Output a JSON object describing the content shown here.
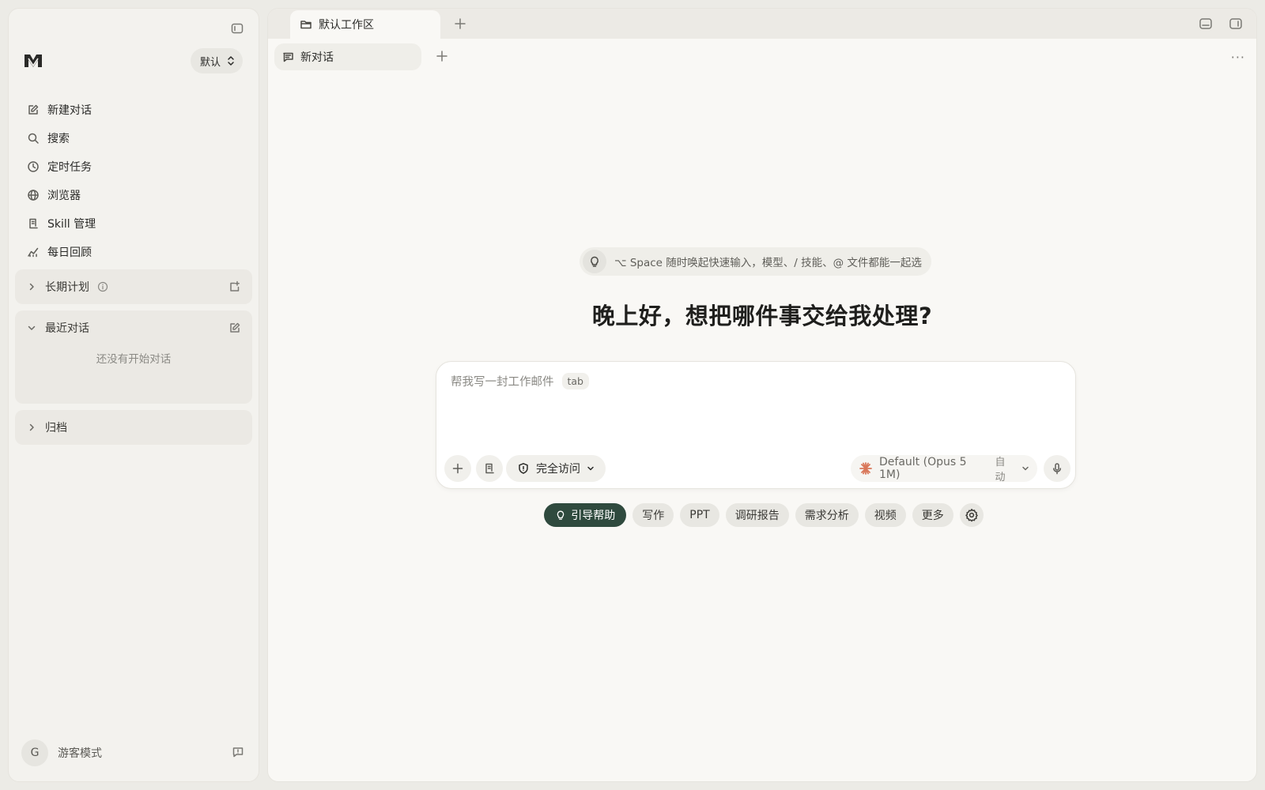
{
  "sidebar": {
    "workspace_selector": "默认",
    "nav": [
      {
        "label": "新建对话",
        "icon": "edit-icon"
      },
      {
        "label": "搜索",
        "icon": "search-icon"
      },
      {
        "label": "定时任务",
        "icon": "clock-icon"
      },
      {
        "label": "浏览器",
        "icon": "globe-icon"
      },
      {
        "label": "Skill 管理",
        "icon": "scroll-icon"
      },
      {
        "label": "每日回顾",
        "icon": "chart-icon"
      }
    ],
    "sections": {
      "long_term": {
        "label": "长期计划"
      },
      "recent": {
        "label": "最近对话",
        "empty_text": "还没有开始对话"
      },
      "archive": {
        "label": "归档"
      }
    },
    "user": {
      "avatar_letter": "G",
      "name": "游客模式"
    }
  },
  "topbar": {
    "workspace_tab": "默认工作区"
  },
  "chat_tab": {
    "label": "新对话"
  },
  "main": {
    "hint": "⌥ Space 随时唤起快速输入，模型、/ 技能、@ 文件都能一起选",
    "greeting": "晚上好，想把哪件事交给我处理?",
    "composer": {
      "placeholder": "帮我写一封工作邮件",
      "kbd_hint": "tab",
      "access_label": "完全访问",
      "model_label": "Default (Opus 5 1M)",
      "model_mode": "自动"
    },
    "chips": [
      {
        "label": "引导帮助",
        "primary": true
      },
      {
        "label": "写作"
      },
      {
        "label": "PPT"
      },
      {
        "label": "调研报告"
      },
      {
        "label": "需求分析"
      },
      {
        "label": "视频"
      },
      {
        "label": "更多"
      }
    ]
  },
  "colors": {
    "accent": "#2f4a3e",
    "background": "#f9f8f5",
    "sidebar": "#f3f2ee",
    "model_star": "#d9775a"
  }
}
